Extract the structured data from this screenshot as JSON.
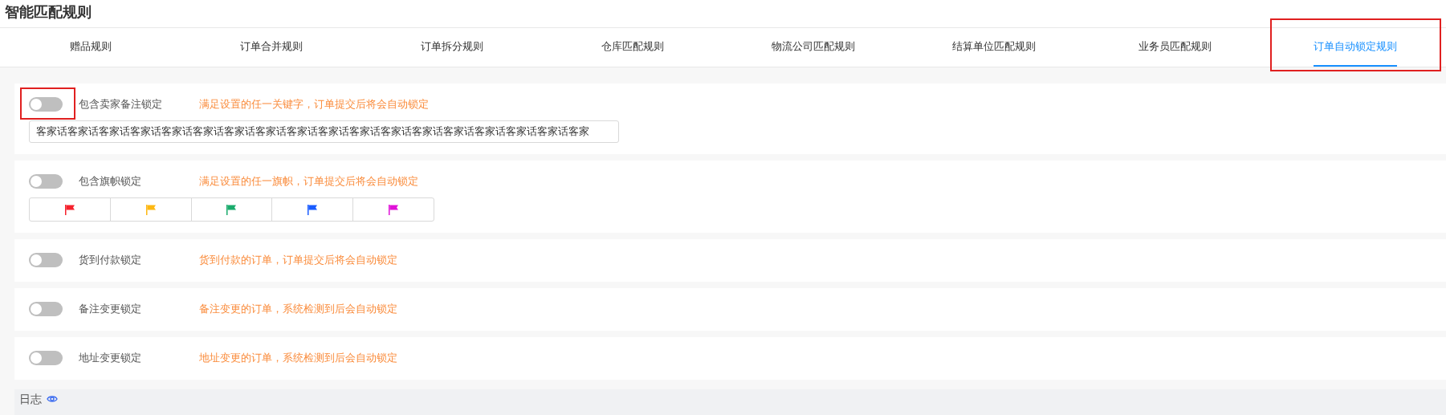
{
  "title": "智能匹配规则",
  "tabs": [
    {
      "label": "赠品规则",
      "selected": false,
      "highlighted": false
    },
    {
      "label": "订单合并规则",
      "selected": false,
      "highlighted": false
    },
    {
      "label": "订单拆分规则",
      "selected": false,
      "highlighted": false
    },
    {
      "label": "仓库匹配规则",
      "selected": false,
      "highlighted": false
    },
    {
      "label": "物流公司匹配规则",
      "selected": false,
      "highlighted": false
    },
    {
      "label": "结算单位匹配规则",
      "selected": false,
      "highlighted": false
    },
    {
      "label": "业务员匹配规则",
      "selected": false,
      "highlighted": false
    },
    {
      "label": "订单自动锁定规则",
      "selected": true,
      "highlighted": true
    }
  ],
  "rules": [
    {
      "kind": "keywords",
      "label": "包含卖家备注锁定",
      "on": false,
      "highlighted": true,
      "hint": "满足设置的任一关键字，订单提交后将会自动锁定",
      "value": "客家话客家话客家话客家话客家话客家话客家话客家话客家话客家话客家话客家话客家话客家话客家话客家话客家话客家"
    },
    {
      "kind": "flags",
      "label": "包含旗帜锁定",
      "on": false,
      "highlighted": false,
      "hint": "满足设置的任一旗帜，订单提交后将会自动锁定",
      "flags": [
        {
          "color": "#f5222d"
        },
        {
          "color": "#fdb813"
        },
        {
          "color": "#1aab6c"
        },
        {
          "color": "#1a5cff"
        },
        {
          "color": "#e011d8"
        }
      ]
    },
    {
      "kind": "plain",
      "label": "货到付款锁定",
      "on": false,
      "highlighted": false,
      "hint": "货到付款的订单，订单提交后将会自动锁定"
    },
    {
      "kind": "plain",
      "label": "备注变更锁定",
      "on": false,
      "highlighted": false,
      "hint": "备注变更的订单，系统检测到后会自动锁定"
    },
    {
      "kind": "plain",
      "label": "地址变更锁定",
      "on": false,
      "highlighted": false,
      "hint": "地址变更的订单，系统检测到后会自动锁定"
    }
  ],
  "log": {
    "label": "日志"
  }
}
